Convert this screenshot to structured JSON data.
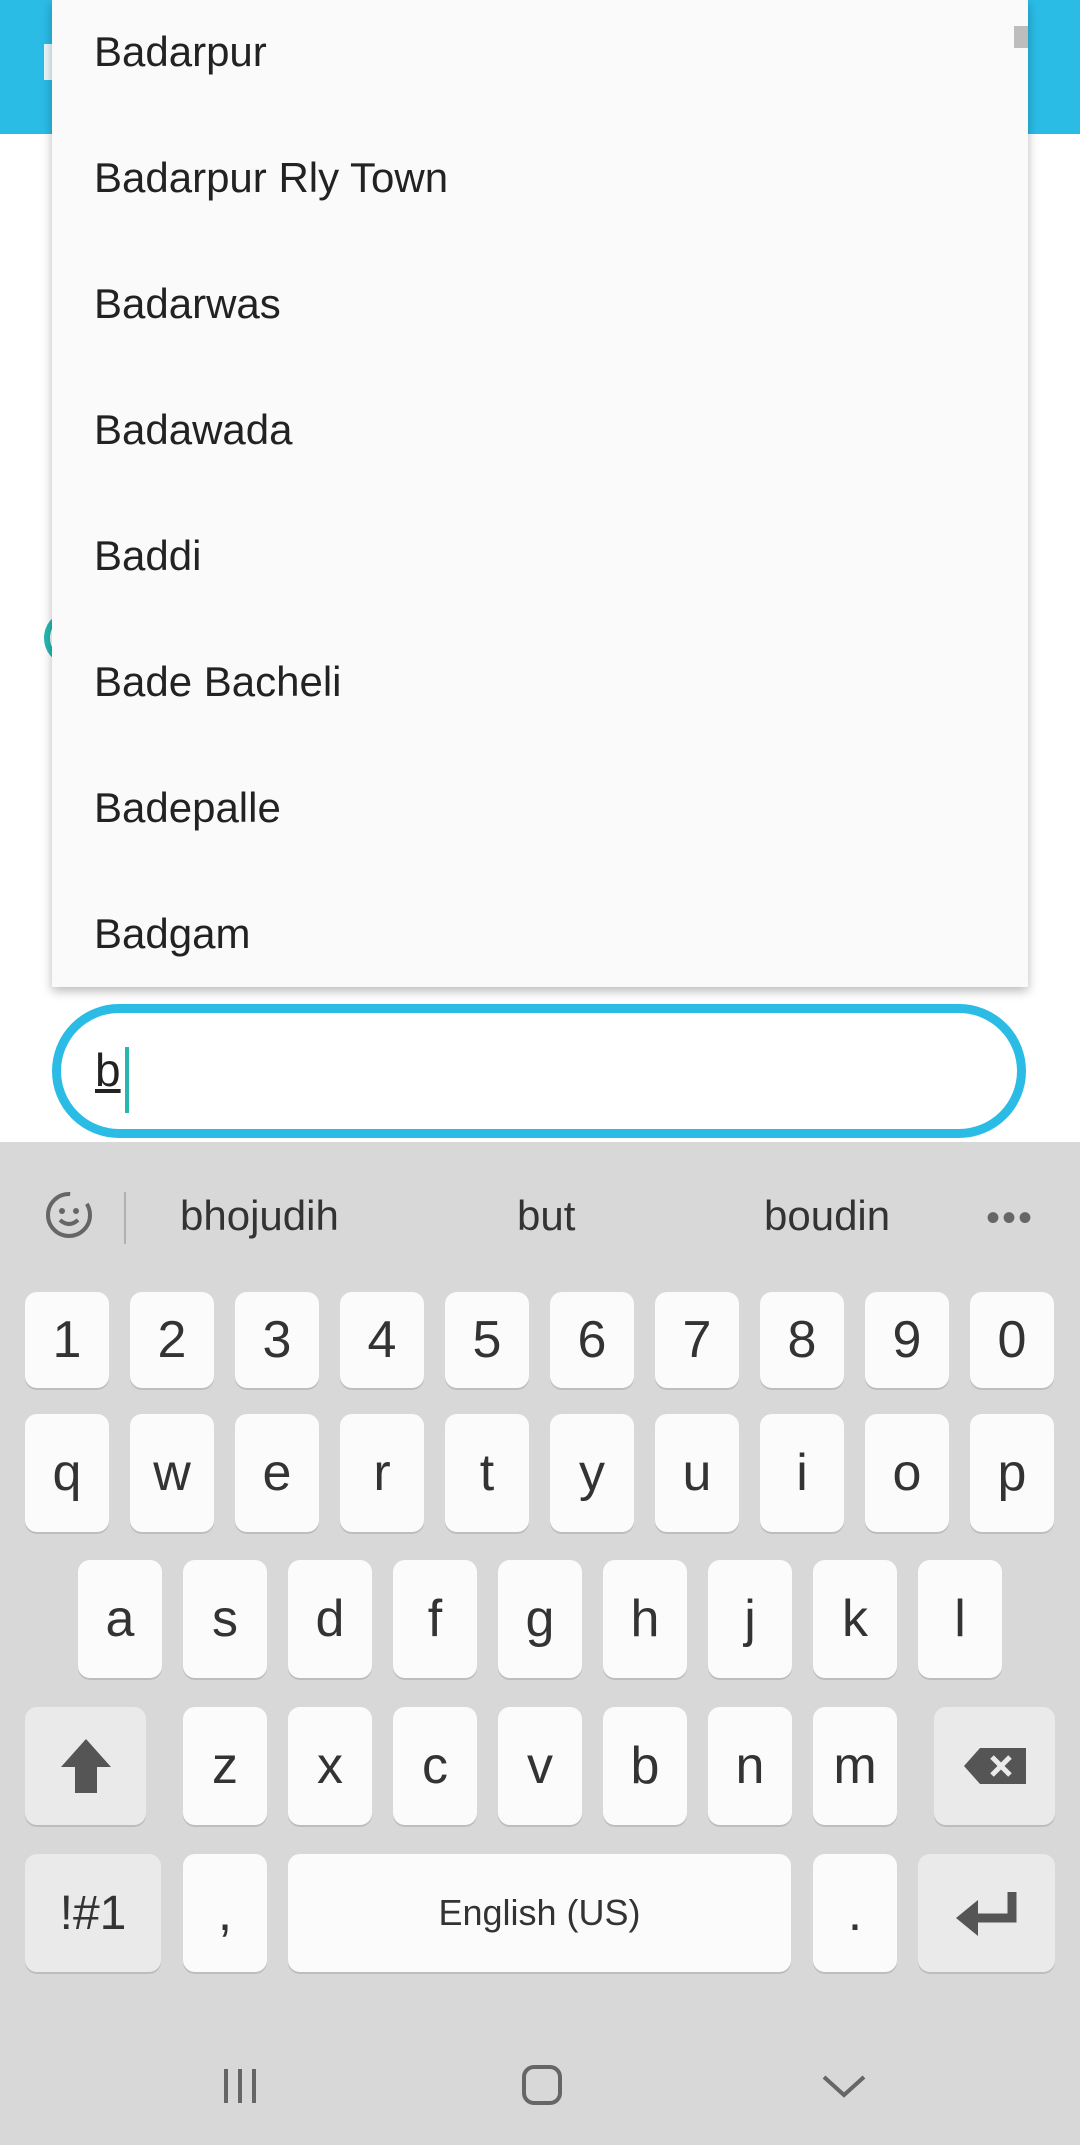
{
  "dropdown": {
    "items": [
      "Badarpur",
      "Badarpur Rly Town",
      "Badarwas",
      "Badawada",
      "Baddi",
      "Bade Bacheli",
      "Badepalle",
      "Badgam"
    ]
  },
  "input": {
    "value": "b"
  },
  "keyboard": {
    "suggestions": [
      "bhojudih",
      "but",
      "boudin"
    ],
    "rows": {
      "numbers": [
        "1",
        "2",
        "3",
        "4",
        "5",
        "6",
        "7",
        "8",
        "9",
        "0"
      ],
      "row1": [
        "q",
        "w",
        "e",
        "r",
        "t",
        "y",
        "u",
        "i",
        "o",
        "p"
      ],
      "row2": [
        "a",
        "s",
        "d",
        "f",
        "g",
        "h",
        "j",
        "k",
        "l"
      ],
      "row3": [
        "z",
        "x",
        "c",
        "v",
        "b",
        "n",
        "m"
      ]
    },
    "symbols_label": "!#1",
    "comma_label": ",",
    "space_label": "English (US)",
    "period_label": "."
  }
}
